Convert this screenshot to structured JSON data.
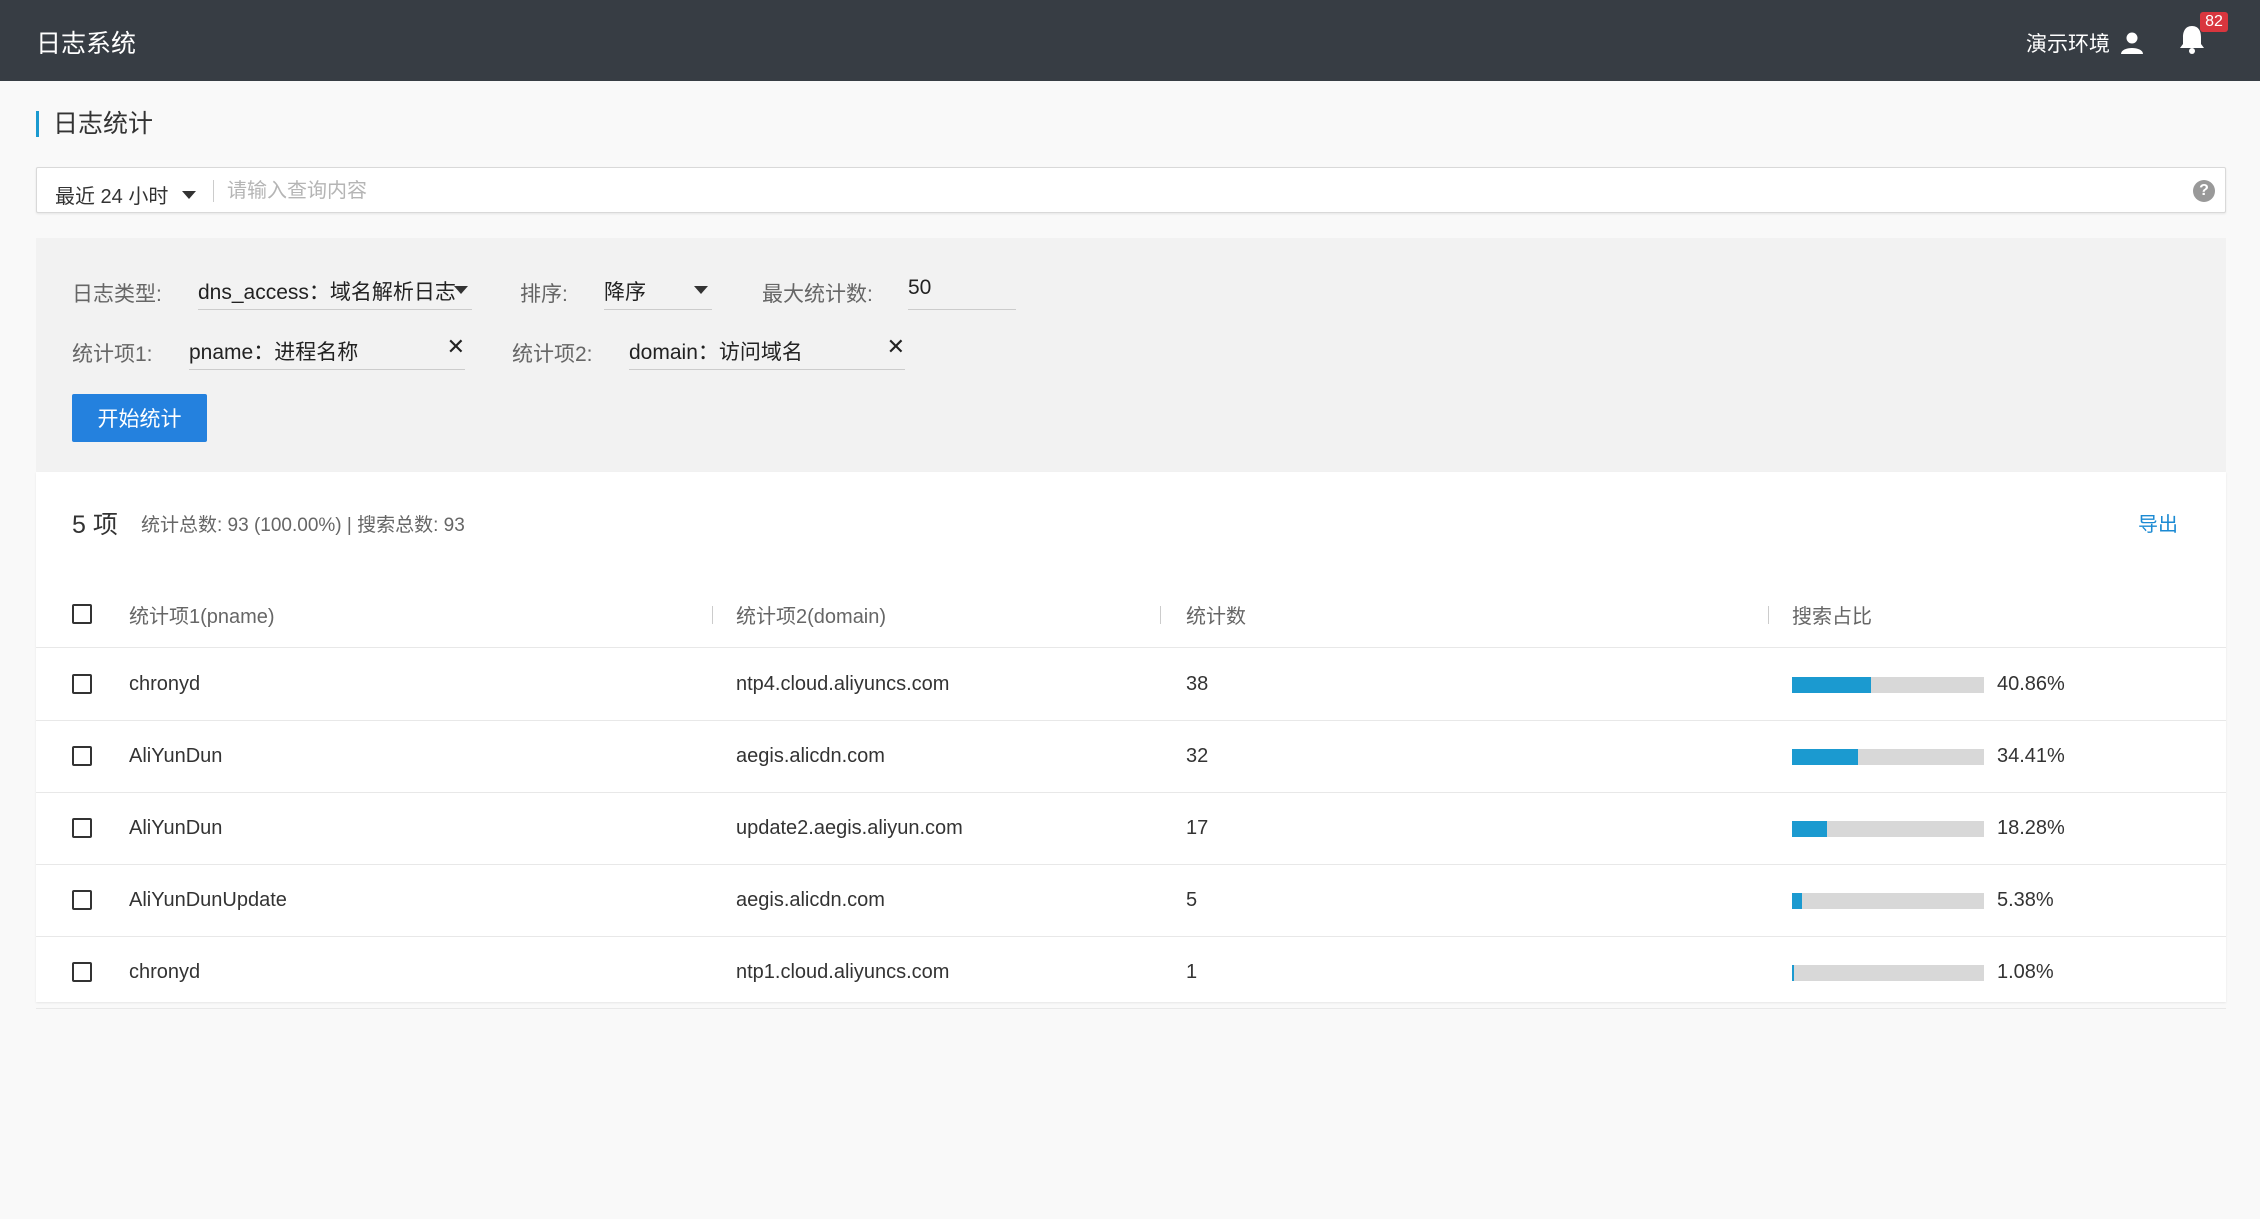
{
  "header": {
    "app_title": "日志系统",
    "environment": "演示环境",
    "notification_count": "82",
    "user_icon": "user-icon",
    "bell_icon": "bell-icon"
  },
  "page": {
    "title": "日志统计"
  },
  "query": {
    "time_range": "最近 24 小时",
    "placeholder": "请输入查询内容",
    "help_icon": "help-icon"
  },
  "filters": {
    "log_type_label": "日志类型:",
    "log_type_value": "dns_access：域名解析日志",
    "sort_label": "排序:",
    "sort_value": "降序",
    "max_count_label": "最大统计数:",
    "max_count_value": "50",
    "item1_label": "统计项1:",
    "item1_value": "pname：进程名称",
    "item2_label": "统计项2:",
    "item2_value": "domain：访问域名",
    "start_button": "开始统计"
  },
  "results": {
    "count_label": "5 项",
    "summary": "统计总数: 93 (100.00%) | 搜索总数: 93",
    "export_label": "导出",
    "columns": [
      "统计项1(pname)",
      "统计项2(domain)",
      "统计数",
      "搜索占比"
    ],
    "rows": [
      {
        "pname": "chronyd",
        "domain": "ntp4.cloud.aliyuncs.com",
        "count": "38",
        "percent_label": "40.86%",
        "percent": 40.86
      },
      {
        "pname": "AliYunDun",
        "domain": "aegis.alicdn.com",
        "count": "32",
        "percent_label": "34.41%",
        "percent": 34.41
      },
      {
        "pname": "AliYunDun",
        "domain": "update2.aegis.aliyun.com",
        "count": "17",
        "percent_label": "18.28%",
        "percent": 18.28
      },
      {
        "pname": "AliYunDunUpdate",
        "domain": "aegis.alicdn.com",
        "count": "5",
        "percent_label": "5.38%",
        "percent": 5.38
      },
      {
        "pname": "chronyd",
        "domain": "ntp1.cloud.aliyuncs.com",
        "count": "1",
        "percent_label": "1.08%",
        "percent": 1.08
      }
    ]
  },
  "colors": {
    "topbar": "#373d44",
    "accent": "#1b9ad0",
    "primary_button": "#2481de",
    "link": "#1b8ad3",
    "badge": "#d9363e"
  }
}
